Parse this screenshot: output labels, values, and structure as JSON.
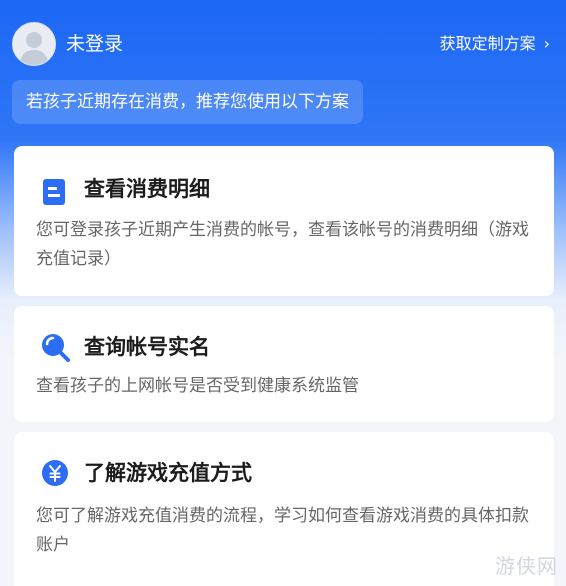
{
  "header": {
    "username": "未登录",
    "plan_link": "获取定制方案",
    "plan_chevron": "›"
  },
  "tip": "若孩子近期存在消费，推荐您使用以下方案",
  "cards": [
    {
      "icon": "document-icon",
      "title": "查看消费明细",
      "desc": "您可登录孩子近期产生消费的帐号，查看该帐号的消费明细（游戏充值记录）"
    },
    {
      "icon": "search-icon",
      "title": "查询帐号实名",
      "desc": "查看孩子的上网帐号是否受到健康系统监管"
    },
    {
      "icon": "yuan-coin-icon",
      "title": "了解游戏充值方式",
      "desc": "您可了解游戏充值消费的流程，学习如何查看游戏消费的具体扣款账户"
    }
  ],
  "watermark": "游侠网",
  "colors": {
    "primary": "#1c67f5",
    "icon_blue": "#2b6df3"
  }
}
